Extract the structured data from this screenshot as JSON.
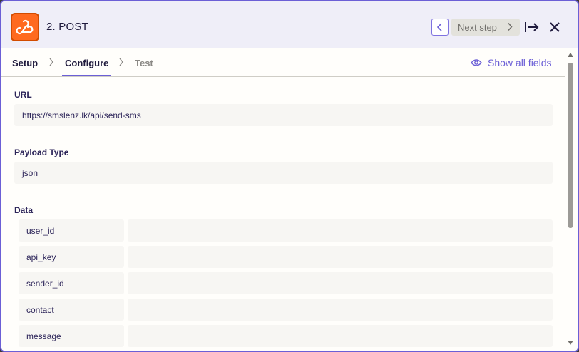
{
  "header": {
    "app_icon": "webhook-icon",
    "step_title": "2. POST",
    "next_step_label": "Next step",
    "colors": {
      "accent": "#6b5fd6",
      "app_icon_bg": "#ff6a1f",
      "header_bg": "#efeef8"
    }
  },
  "tabs": [
    {
      "label": "Setup",
      "state": "done"
    },
    {
      "label": "Configure",
      "state": "active"
    },
    {
      "label": "Test",
      "state": "inactive"
    }
  ],
  "show_all_fields_label": "Show all fields",
  "fields": {
    "url": {
      "label": "URL",
      "value": "https://smslenz.lk/api/send-sms"
    },
    "payload_type": {
      "label": "Payload Type",
      "value": "json"
    },
    "data": {
      "label": "Data",
      "rows": [
        {
          "key": "user_id",
          "value": ""
        },
        {
          "key": "api_key",
          "value": ""
        },
        {
          "key": "sender_id",
          "value": ""
        },
        {
          "key": "contact",
          "value": ""
        },
        {
          "key": "message",
          "value": ""
        }
      ]
    }
  }
}
